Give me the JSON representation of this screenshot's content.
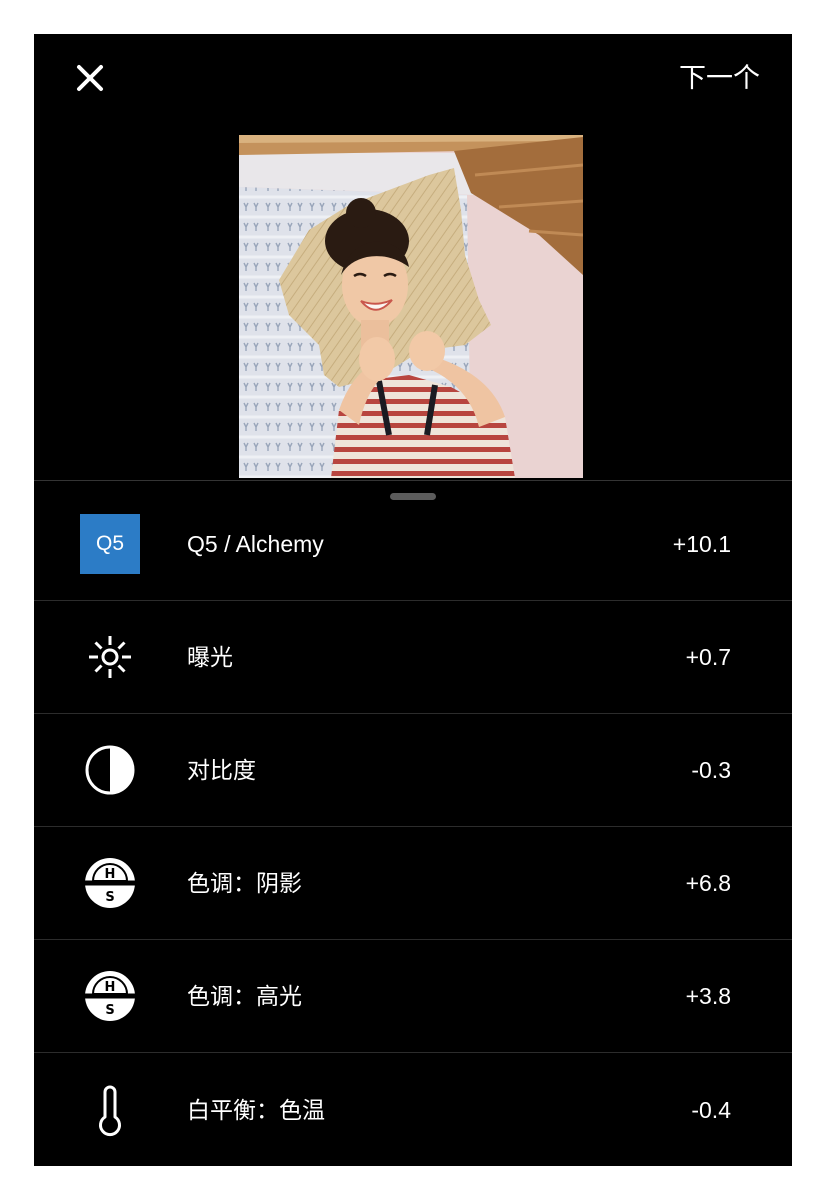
{
  "header": {
    "close_icon": "close-icon",
    "next_label": "下一个"
  },
  "colors": {
    "background": "#000000",
    "text": "#ffffff",
    "badge": "#2c7cc6",
    "divider": "#2c2c2c"
  },
  "adjustments": [
    {
      "icon": "q5-badge",
      "badge": "Q5",
      "label": "Q5 / Alchemy",
      "value": "+10.1"
    },
    {
      "icon": "sun-icon",
      "label": "曝光",
      "value": "+0.7"
    },
    {
      "icon": "contrast-icon",
      "label": "对比度",
      "value": "-0.3"
    },
    {
      "icon": "hue-saturation-icon",
      "icon_letters": [
        "H",
        "S"
      ],
      "label": "色调：阴影",
      "value": "+6.8"
    },
    {
      "icon": "hue-saturation-icon",
      "icon_letters": [
        "H",
        "S"
      ],
      "label": "色调：高光",
      "value": "+3.8"
    },
    {
      "icon": "thermometer-icon",
      "label": "白平衡：色温",
      "value": "-0.4"
    }
  ]
}
